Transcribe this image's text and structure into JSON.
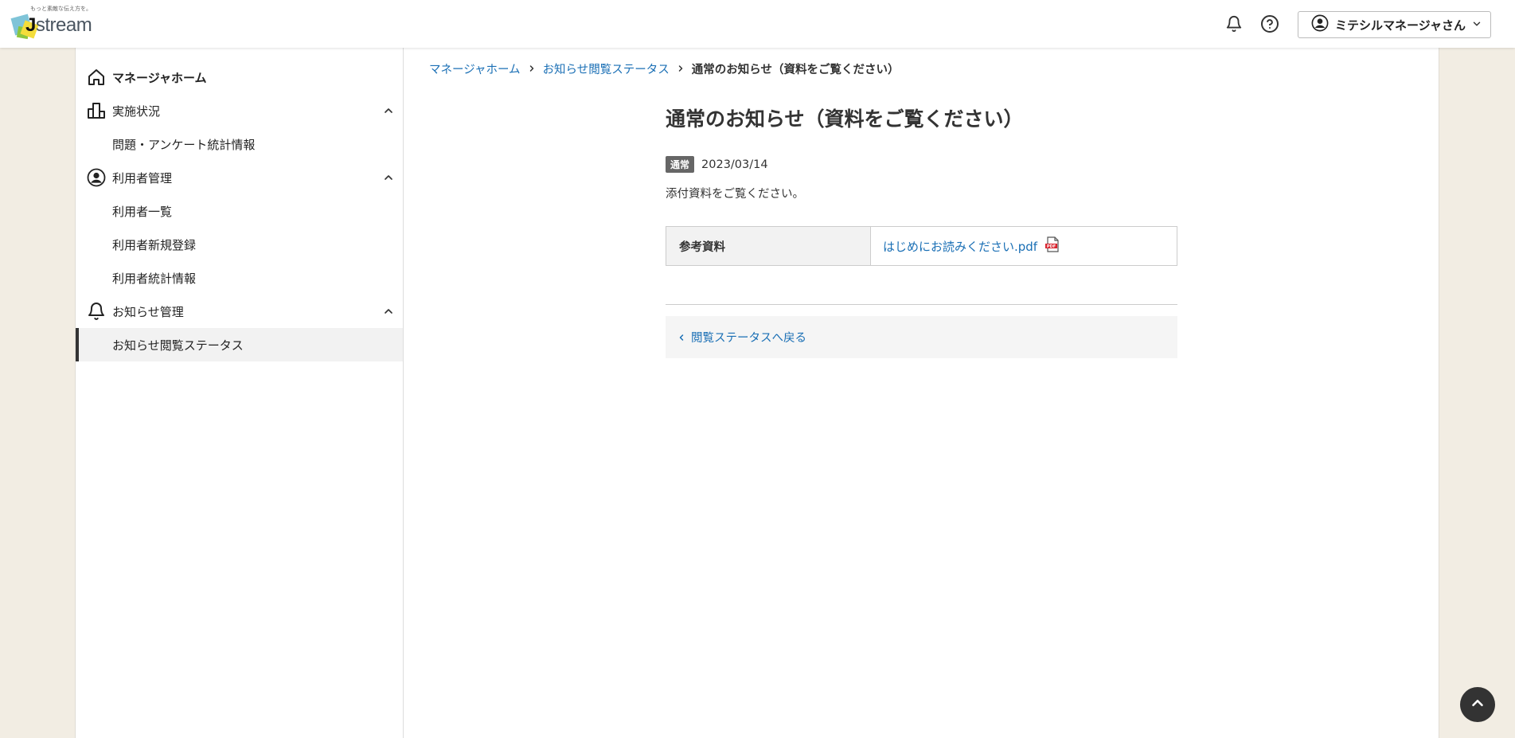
{
  "header": {
    "logo_tagline": "もっと素敵な伝え方を。",
    "logo_text_prefix": "J",
    "logo_text_rest": "stream",
    "notifications_icon": "bell-icon",
    "help_icon": "help-circle-icon",
    "user_name": "ミテシルマネージャさん"
  },
  "sidebar": {
    "items": [
      {
        "label": "マネージャホーム",
        "icon": "home-icon"
      },
      {
        "label": "実施状況",
        "icon": "building-icon"
      },
      {
        "label": "問題・アンケート統計情報"
      },
      {
        "label": "利用者管理",
        "icon": "user-circle-icon"
      },
      {
        "label": "利用者一覧"
      },
      {
        "label": "利用者新規登録"
      },
      {
        "label": "利用者統計情報"
      },
      {
        "label": "お知らせ管理",
        "icon": "bell-icon"
      },
      {
        "label": "お知らせ閲覧ステータス"
      }
    ]
  },
  "breadcrumb": {
    "items": [
      "マネージャホーム",
      "お知らせ閲覧ステータス"
    ],
    "current": "通常のお知らせ（資料をご覧ください）"
  },
  "notice": {
    "title": "通常のお知らせ（資料をご覧ください）",
    "badge": "通常",
    "date": "2023/03/14",
    "body": "添付資料をご覧ください。",
    "attachment_header": "参考資料",
    "attachment_link": "はじめにお読みください.pdf",
    "back_link": "閲覧ステータスへ戻る"
  },
  "colors": {
    "link": "#1a6fb5",
    "background": "#f2ede3",
    "badge": "#666666"
  }
}
